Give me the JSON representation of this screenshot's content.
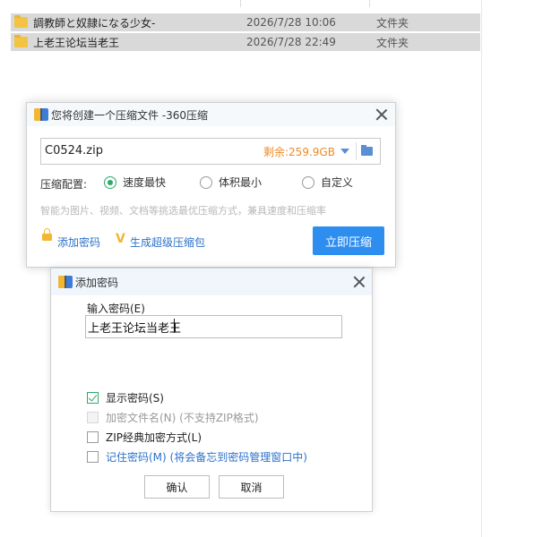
{
  "explorer": {
    "rows": [
      {
        "name": "調教師と奴隷になる少女-",
        "date": "2026/7/28 10:06",
        "type": "文件夹"
      },
      {
        "name": "上老王论坛当老王",
        "date": "2026/7/28 22:49",
        "type": "文件夹"
      }
    ]
  },
  "compress_dialog": {
    "title": "您将创建一个压缩文件 -360压缩",
    "filename": "C0524.zip",
    "free_space": "剩余:259.9GB",
    "config_label": "压缩配置:",
    "options": [
      {
        "label": "速度最快",
        "checked": true
      },
      {
        "label": "体积最小",
        "checked": false
      },
      {
        "label": "自定义",
        "checked": false
      }
    ],
    "hint": "智能为图片、视频、文档等挑选最优压缩方式，兼具速度和压缩率",
    "add_password": "添加密码",
    "super_package": "生成超级压缩包",
    "compress_button": "立即压缩"
  },
  "password_dialog": {
    "title": "添加密码",
    "input_label": "输入密码(E)",
    "password_value": "上老王论坛当老王",
    "checkboxes": [
      {
        "label": "显示密码(S)",
        "checked": true,
        "disabled": false
      },
      {
        "label": "加密文件名(N) (不支持ZIP格式)",
        "checked": false,
        "disabled": true
      },
      {
        "label": "ZIP经典加密方式(L)",
        "checked": false,
        "disabled": false
      },
      {
        "label": "记住密码(M) (将会备忘到密码管理窗口中)",
        "checked": false,
        "disabled": false
      }
    ],
    "ok_button": "确认",
    "cancel_button": "取消"
  },
  "colors": {
    "accent": "#2e8ef0",
    "link": "#2b72c9",
    "radio_check": "#2fa868",
    "free_space": "#f08a24"
  }
}
